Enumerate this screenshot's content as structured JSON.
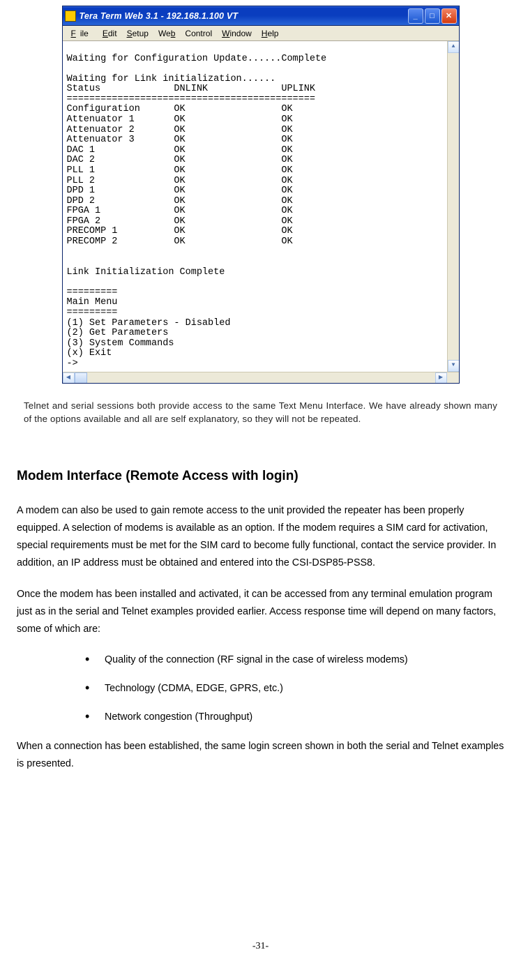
{
  "window": {
    "title": "Tera Term Web 3.1 - 192.168.1.100 VT",
    "menu": {
      "file": "File",
      "edit": "Edit",
      "setup": "Setup",
      "web": "Web",
      "control": "Control",
      "window": "Window",
      "help": "Help"
    },
    "terminal_text": "Waiting for Configuration Update......Complete\n\nWaiting for Link initialization......\nStatus             DNLINK             UPLINK\n============================================\nConfiguration      OK                 OK\nAttenuator 1       OK                 OK\nAttenuator 2       OK                 OK\nAttenuator 3       OK                 OK\nDAC 1              OK                 OK\nDAC 2              OK                 OK\nPLL 1              OK                 OK\nPLL 2              OK                 OK\nDPD 1              OK                 OK\nDPD 2              OK                 OK\nFPGA 1             OK                 OK\nFPGA 2             OK                 OK\nPRECOMP 1          OK                 OK\nPRECOMP 2          OK                 OK\n\n\nLink Initialization Complete\n\n=========\nMain Menu\n=========\n(1) Set Parameters - Disabled\n(2) Get Parameters\n(3) System Commands\n(x) Exit\n->"
  },
  "paragraphs": {
    "intro": "Telnet and serial sessions both provide access to the same Text Menu Interface. We have already shown many of the options available and all are self explanatory, so they will not be repeated.",
    "heading": "Modem Interface (Remote Access with login)",
    "p1": "A modem can also be used to gain remote access to the unit provided the repeater has been properly equipped. A selection of modems is available as an option. If the modem requires a SIM card for activation, special requirements must be met for the SIM card to become fully functional, contact the service provider. In addition, an IP address must be obtained and entered into the CSI-DSP85-PSS8.",
    "p2": "Once the modem has been installed and activated, it can be accessed from any terminal emulation program just as in the serial and Telnet examples provided earlier.  Access response time will depend on many factors, some of which are:",
    "bullets": [
      "Quality of the connection (RF signal in the case of wireless modems)",
      "Technology (CDMA, EDGE, GPRS, etc.)",
      "Network congestion (Throughput)"
    ],
    "p3": "When a connection has been established,  the same login screen shown in both the serial and Telnet examples is presented."
  },
  "page_number": "-31-"
}
